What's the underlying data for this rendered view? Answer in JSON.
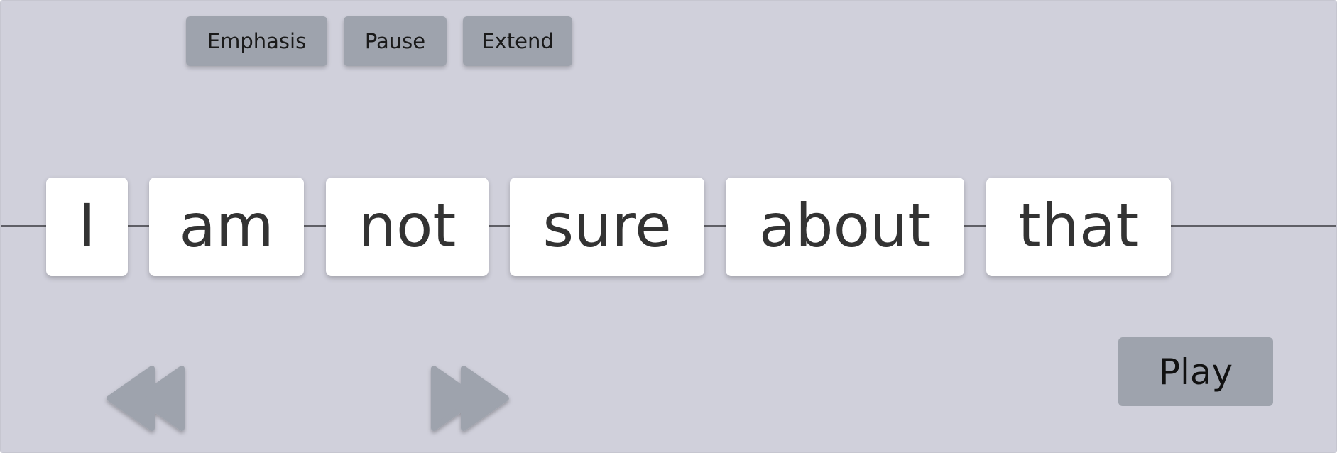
{
  "toolbar": {
    "emphasis_label": "Emphasis",
    "pause_label": "Pause",
    "extend_label": "Extend"
  },
  "sentence": {
    "words": [
      "I",
      "am",
      "not",
      "sure",
      "about",
      "that"
    ]
  },
  "controls": {
    "rewind_icon": "rewind-icon",
    "forward_icon": "fast-forward-icon",
    "play_label": "Play"
  },
  "colors": {
    "background": "#d0d0db",
    "button": "#9ea3ad",
    "word_card": "#ffffff",
    "timeline": "#5f5f66"
  }
}
